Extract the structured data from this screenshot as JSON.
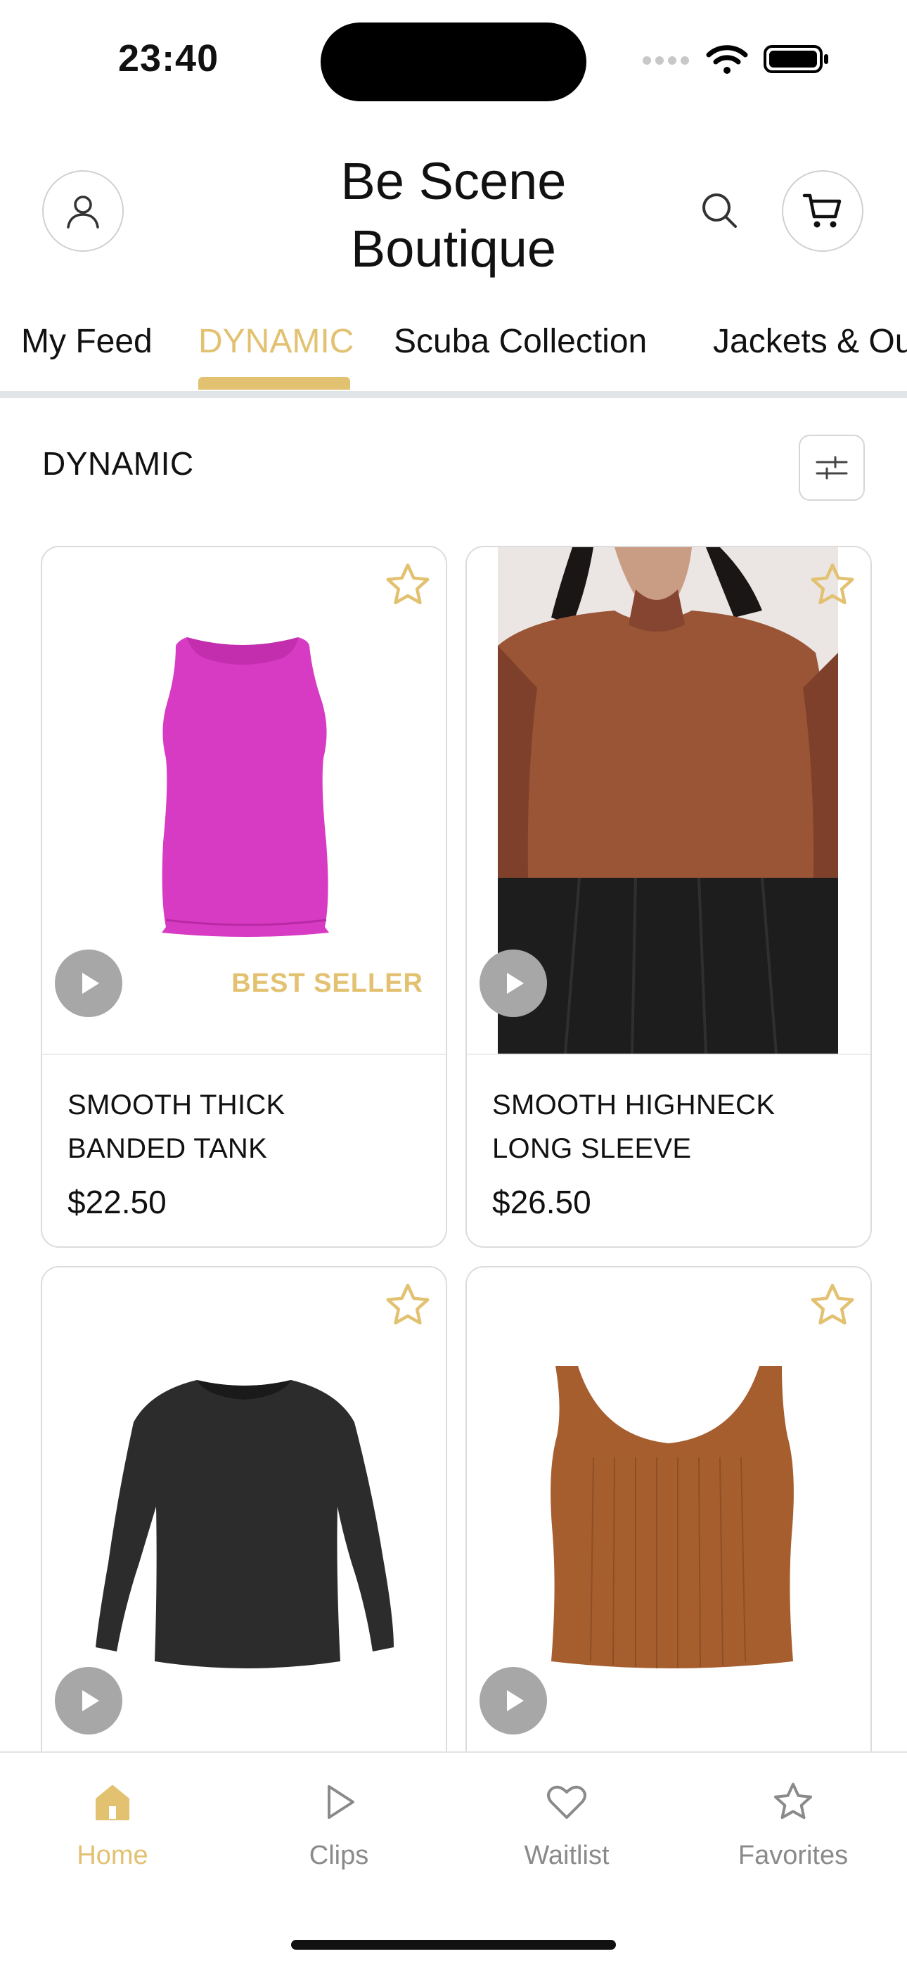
{
  "status": {
    "time": "23:40"
  },
  "header": {
    "title_line1": "Be Scene",
    "title_line2": "Boutique"
  },
  "tabs": [
    {
      "label": "My Feed",
      "active": false
    },
    {
      "label": "DYNAMIC",
      "active": true
    },
    {
      "label": "Scuba Collection",
      "active": false
    },
    {
      "label": "Jackets & Ou",
      "active": false
    }
  ],
  "section": {
    "title": "DYNAMIC"
  },
  "products": [
    {
      "name_line1": "SMOOTH THICK",
      "name_line2": "BANDED TANK",
      "price": "$22.50",
      "badge": "BEST SELLER",
      "color": "#d73ac3"
    },
    {
      "name_line1": "SMOOTH HIGHNECK",
      "name_line2": "LONG SLEEVE",
      "price": "$26.50",
      "badge": "",
      "color": "#9a5436"
    },
    {
      "name_line1": "",
      "name_line2": "",
      "price": "",
      "badge": "",
      "color": "#2c2c2c"
    },
    {
      "name_line1": "",
      "name_line2": "",
      "price": "",
      "badge": "",
      "color": "#a65e2f"
    }
  ],
  "bottom_nav": [
    {
      "label": "Home",
      "icon": "home-icon",
      "active": true
    },
    {
      "label": "Clips",
      "icon": "play-icon",
      "active": false
    },
    {
      "label": "Waitlist",
      "icon": "heart-icon",
      "active": false
    },
    {
      "label": "Favorites",
      "icon": "star-icon",
      "active": false
    }
  ],
  "colors": {
    "accent": "#e2c170",
    "muted": "#8a8a8a"
  }
}
